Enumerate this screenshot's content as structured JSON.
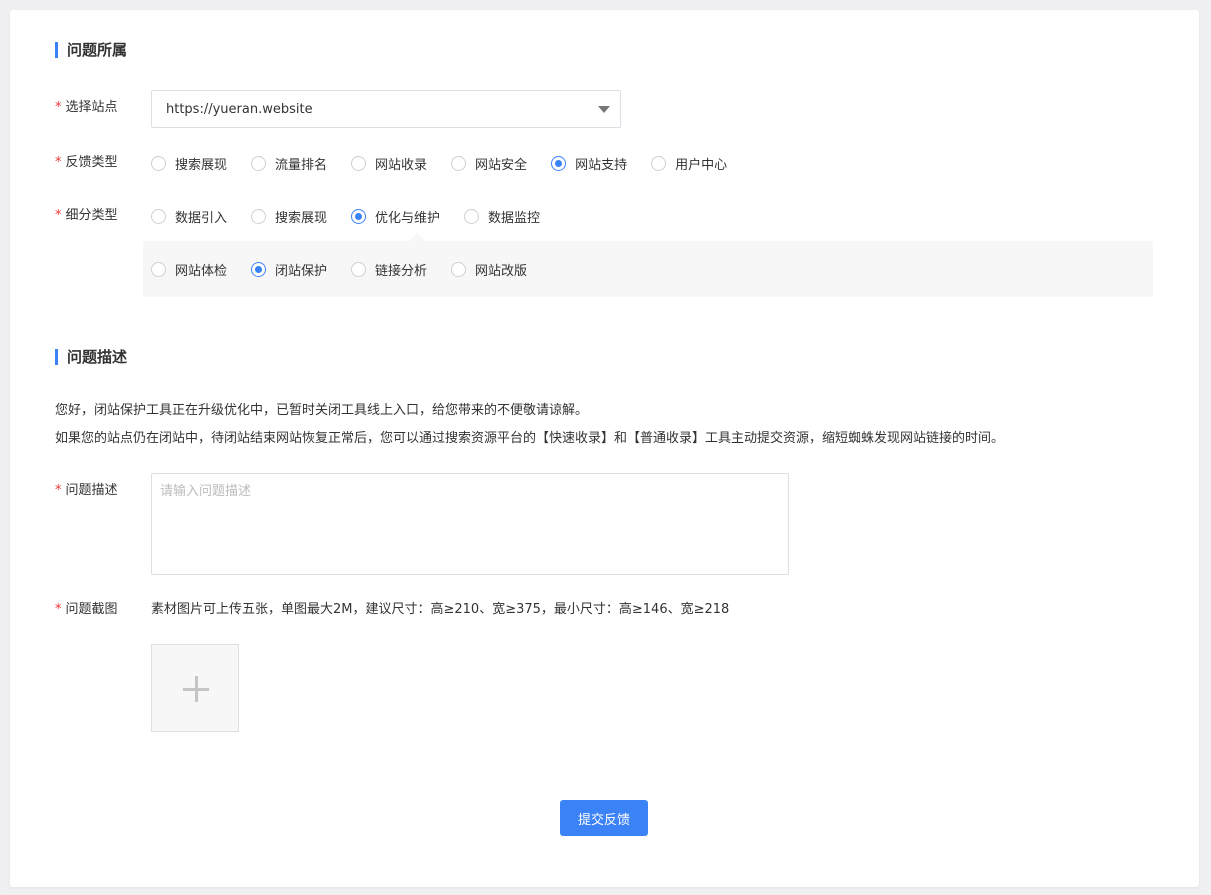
{
  "section_ownership": {
    "title": "问题所属"
  },
  "site": {
    "label": "选择站点",
    "value": "https://yueran.website"
  },
  "feedback_type": {
    "label": "反馈类型",
    "options": [
      "搜索展现",
      "流量排名",
      "网站收录",
      "网站安全",
      "网站支持",
      "用户中心"
    ],
    "selected": "网站支持"
  },
  "sub_type": {
    "label": "细分类型",
    "options": [
      "数据引入",
      "搜索展现",
      "优化与维护",
      "数据监控"
    ],
    "selected": "优化与维护"
  },
  "sub_sub_type": {
    "options": [
      "网站体检",
      "闭站保护",
      "链接分析",
      "网站改版"
    ],
    "selected": "闭站保护"
  },
  "section_description": {
    "title": "问题描述"
  },
  "notice": {
    "line1": "您好，闭站保护工具正在升级优化中，已暂时关闭工具线上入口，给您带来的不便敬请谅解。",
    "line2": "如果您的站点仍在闭站中，待闭站结束网站恢复正常后，您可以通过搜索资源平台的【快速收录】和【普通收录】工具主动提交资源，缩短蜘蛛发现网站链接的时间。"
  },
  "description": {
    "label": "问题描述",
    "placeholder": "请输入问题描述",
    "value": ""
  },
  "screenshot": {
    "label": "问题截图",
    "hint": "素材图片可上传五张，单图最大2M，建议尺寸：高≥210、宽≥375，最小尺寸：高≥146、宽≥218",
    "add_icon": "plus-icon"
  },
  "submit_label": "提交反馈",
  "colors": {
    "accent": "#3b82f6",
    "required": "#e33333"
  }
}
